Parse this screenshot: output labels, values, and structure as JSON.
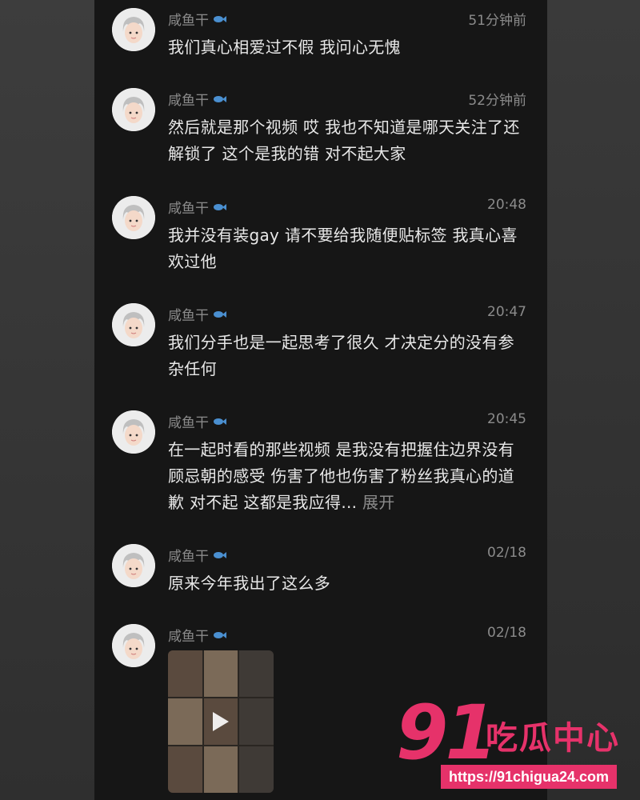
{
  "accent_color": "#e6326a",
  "comments": [
    {
      "user": "咸鱼干",
      "time": "51分钟前",
      "text": "我们真心相爱过不假 我问心无愧",
      "expand": ""
    },
    {
      "user": "咸鱼干",
      "time": "52分钟前",
      "text": "然后就是那个视频 哎 我也不知道是哪天关注了还解锁了 这个是我的错 对不起大家",
      "expand": ""
    },
    {
      "user": "咸鱼干",
      "time": "20:48",
      "text": "我并没有装gay 请不要给我随便贴标签 我真心喜欢过他",
      "expand": ""
    },
    {
      "user": "咸鱼干",
      "time": "20:47",
      "text": "我们分手也是一起思考了很久 才决定分的没有参杂任何",
      "expand": ""
    },
    {
      "user": "咸鱼干",
      "time": "20:45",
      "text": "在一起时看的那些视频 是我没有把握住边界没有顾忌朝的感受 伤害了他也伤害了粉丝我真心的道歉 对不起 这都是我应得... ",
      "expand": "展开"
    },
    {
      "user": "咸鱼干",
      "time": "02/18",
      "text": "原来今年我出了这么多",
      "expand": ""
    },
    {
      "user": "咸鱼干",
      "time": "02/18",
      "text": "",
      "expand": "",
      "has_video": true
    }
  ],
  "watermark": {
    "number": "91",
    "brand": "吃瓜中心",
    "url": "https://91chigua24.com"
  }
}
